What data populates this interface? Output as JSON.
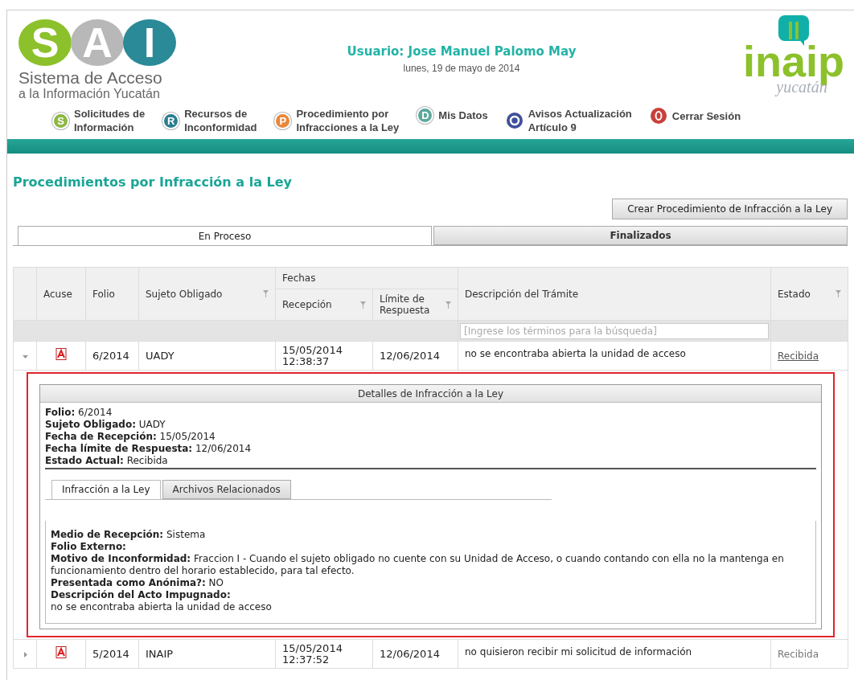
{
  "logo": {
    "letters": [
      "S",
      "A",
      "I"
    ],
    "line1": "Sistema de Acceso",
    "line2": "a la Información Yucatán"
  },
  "user": {
    "title": "Usuario: Jose Manuel Palomo May",
    "date": "lunes, 19 de mayo de 2014"
  },
  "brand": {
    "name": "inaip",
    "region": "yucatán"
  },
  "nav": [
    {
      "kind": "letter",
      "badge": "S",
      "color": "#8db843",
      "label": "Solicitudes de\nInformación"
    },
    {
      "kind": "letter",
      "badge": "R",
      "color": "#2a7f8f",
      "label": "Recursos de\nInconformidad"
    },
    {
      "kind": "letter",
      "badge": "P",
      "color": "#e8873a",
      "label": "Procedimiento por\nInfracciones a la Ley"
    },
    {
      "kind": "letter",
      "badge": "D",
      "color": "#5ea89c",
      "label": "Mis Datos"
    },
    {
      "kind": "refresh",
      "color": "#3f4f9c",
      "label": "Avisos Actualización\nArtículo 9"
    },
    {
      "kind": "power",
      "color": "#c9403a",
      "label": "Cerrar Sesión"
    }
  ],
  "page_title": "Procedimientos por Infracción a la Ley",
  "create_button": "Crear Procedimiento de Infracción a la Ley",
  "tabs": [
    {
      "label": "En Proceso",
      "selected": true
    },
    {
      "label": "Finalizados",
      "selected": false
    }
  ],
  "table": {
    "columns": {
      "acuse": "Acuse",
      "folio": "Folio",
      "sujeto": "Sujeto Obligado",
      "fechas": "Fechas",
      "recepcion": "Recepción",
      "limite": "Límite de\nRespuesta",
      "descripcion": "Descripción del Trámite",
      "estado": "Estado"
    },
    "search_placeholder": "[Ingrese los términos para la búsqueda]",
    "rows": [
      {
        "folio": "6/2014",
        "sujeto": "UADY",
        "recepcion": "15/05/2014\n12:38:37",
        "limite": "12/06/2014",
        "descripcion": "no se encontraba abierta la unidad de acceso",
        "estado": "Recibida",
        "expanded": true,
        "selected": true,
        "details": {
          "highlighted": true,
          "title": "Detalles de Infracción a la Ley",
          "fields": [
            "**Folio:** 6/2014",
            "**Sujeto Obligado:** UADY",
            "**Fecha de Recepción:** 15/05/2014",
            "**Fecha límite de Respuesta:** 12/06/2014",
            "**Estado Actual:** Recibida"
          ],
          "tabs": [
            {
              "label": "Infracción a la Ley",
              "selected": true
            },
            {
              "label": "Archivos Relacionados",
              "selected": false
            }
          ],
          "content": [
            "**Medio de Recepción:** Sistema",
            "**Folio Externo:**",
            "**Motivo de Inconformidad:** Fraccion I - Cuando el sujeto obligado no cuente con su Unidad de Acceso, o cuando contando con ella no la mantenga en funcionamiento dentro del horario establecido, para tal efecto.",
            "**Presentada como Anónima?:** NO",
            "**Descripción del Acto Impugnado:**",
            "no se encontraba abierta la unidad de acceso"
          ]
        }
      },
      {
        "folio": "5/2014",
        "sujeto": "INAIP",
        "recepcion": "15/05/2014\n12:37:52",
        "limite": "12/06/2014",
        "descripcion": "no quisieron recibir mi solicitud de información",
        "estado": "Recibida",
        "expanded": false,
        "selected": false
      }
    ]
  }
}
